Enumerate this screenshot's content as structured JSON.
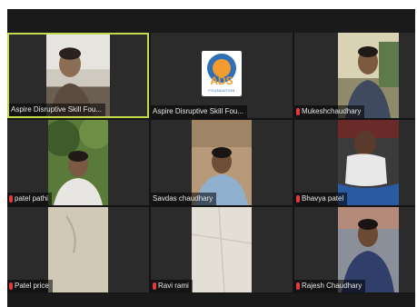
{
  "participants": [
    {
      "name": "Aspire Disruptive Skill Fou...",
      "muted": false,
      "active_speaker": true
    },
    {
      "name": "Aspire Disruptive Skill Fou...",
      "muted": false,
      "active_speaker": false,
      "logo": {
        "text": "ADS",
        "sub": "FOUNDATION"
      }
    },
    {
      "name": "Mukeshchaudhary",
      "muted": true
    },
    {
      "name": "patel pathi",
      "muted": true
    },
    {
      "name": "Savdas chaudhary",
      "muted": false
    },
    {
      "name": "Bhavya patel",
      "muted": true
    },
    {
      "name": "Patel price",
      "muted": true
    },
    {
      "name": "Ravi rami",
      "muted": true
    },
    {
      "name": "Rajesh Chaudhary",
      "muted": true
    }
  ],
  "colors": {
    "active_speaker_border": "#c5d94a",
    "muted_mic": "#e03a3a",
    "background": "#141414",
    "logo_blue": "#2f6fb8",
    "logo_orange": "#f29b2e"
  }
}
